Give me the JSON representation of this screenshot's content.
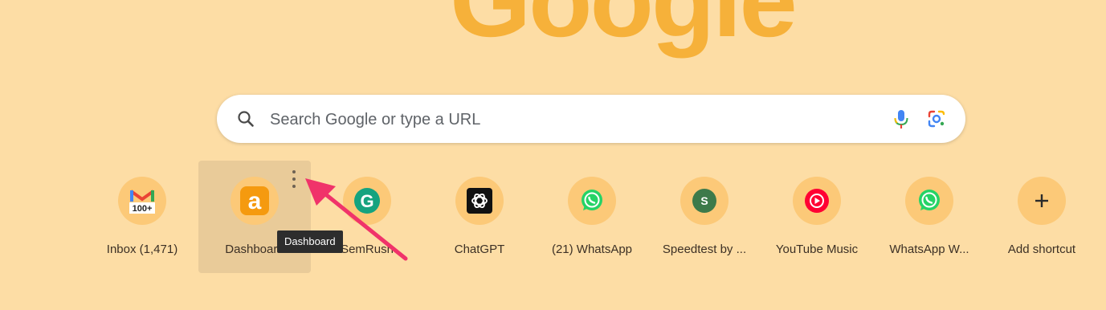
{
  "logo": {
    "text": "Google"
  },
  "search": {
    "placeholder": "Search Google or type a URL",
    "value": ""
  },
  "shortcuts": [
    {
      "label": "Inbox (1,471)",
      "icon": "gmail-icon",
      "badge": "100+"
    },
    {
      "label": "Dashboard",
      "icon": "amazon-a-icon",
      "glyph": "a"
    },
    {
      "label": "SemRush",
      "icon": "grammarly-icon",
      "glyph": "G"
    },
    {
      "label": "ChatGPT",
      "icon": "chatgpt-icon"
    },
    {
      "label": "(21) WhatsApp",
      "icon": "whatsapp-icon"
    },
    {
      "label": "Speedtest by ...",
      "icon": "speedtest-icon",
      "glyph": "S"
    },
    {
      "label": "YouTube Music",
      "icon": "youtube-music-icon"
    },
    {
      "label": "WhatsApp W...",
      "icon": "whatsapp-icon"
    },
    {
      "label": "Add shortcut",
      "icon": "plus-icon",
      "glyph": "+"
    }
  ],
  "tooltip": {
    "text": "Dashboard"
  },
  "colors": {
    "background": "#fddda5",
    "logo": "#f6b13a",
    "tile_circle": "#fcc978",
    "arrow": "#f0336a"
  }
}
